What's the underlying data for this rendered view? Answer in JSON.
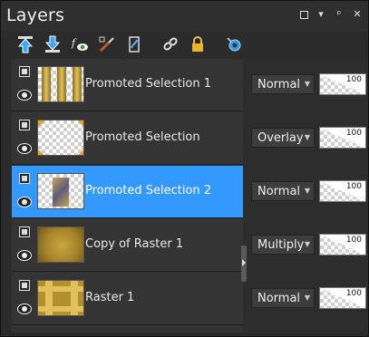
{
  "window": {
    "title": "Layers",
    "controls": [
      "restore-icon",
      "menu-arrow-icon",
      "pin-icon",
      "close-icon"
    ]
  },
  "toolbar": {
    "icons": [
      "move-up-icon",
      "move-down-icon",
      "fx-eye-icon",
      "brush-icon",
      "mask-icon",
      "link-icon",
      "lock-icon",
      "view-icon"
    ]
  },
  "layers": [
    {
      "name": "Promoted Selection 1",
      "blend": "Normal",
      "opacity": "100",
      "selected": false
    },
    {
      "name": "Promoted Selection",
      "blend": "Overlay",
      "opacity": "100",
      "selected": false
    },
    {
      "name": "Promoted Selection 2",
      "blend": "Normal",
      "opacity": "100",
      "selected": true
    },
    {
      "name": "Copy of Raster 1",
      "blend": "Multiply",
      "opacity": "100",
      "selected": false
    },
    {
      "name": "Raster 1",
      "blend": "Normal",
      "opacity": "100",
      "selected": false
    }
  ],
  "colors": {
    "selected": "#3399ff",
    "panel": "#2b2b2b",
    "gold": "#c9a63f"
  }
}
